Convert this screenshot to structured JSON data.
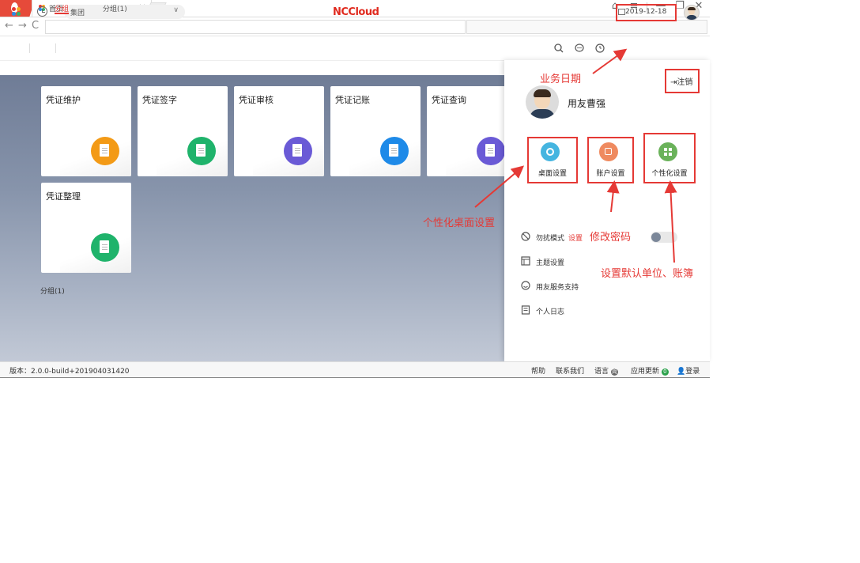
{
  "browser": {
    "tab_title": "首页",
    "tab_close": "×",
    "nav_back": "←",
    "nav_forward": "→",
    "nav_reload": "C",
    "win_controls": [
      "⌂",
      "≡",
      "—",
      "❐",
      "✕"
    ]
  },
  "header": {
    "org_select_value": "集团",
    "org_select_arrow": "∨",
    "logo": "NCCloud",
    "business_date": "2019-12-18"
  },
  "subtabs": [
    "分组",
    "分组(1)"
  ],
  "cards": [
    {
      "title": "凭证维护",
      "color": "#f39a16"
    },
    {
      "title": "凭证签字",
      "color": "#1fb36b"
    },
    {
      "title": "凭证审核",
      "color": "#6a5ad6"
    },
    {
      "title": "凭证记账",
      "color": "#1e8ae8"
    },
    {
      "title": "凭证查询",
      "color": "#6a5ad6"
    },
    {
      "title": "凭证整理",
      "color": "#1fb36b"
    }
  ],
  "group_label": "分组(1)",
  "panel": {
    "logout_label": "注销",
    "user_name": "用友曹强",
    "quick_actions": [
      {
        "label": "桌面设置",
        "color": "#45b5e0"
      },
      {
        "label": "账户设置",
        "color": "#ef8a5f"
      },
      {
        "label": "个性化设置",
        "color": "#6ab25a"
      }
    ],
    "menu": {
      "dnd_label": "勿扰模式",
      "dnd_settings_link": "设置",
      "theme_label": "主题设置",
      "support_label": "用友服务支持",
      "log_label": "个人日志"
    }
  },
  "statusbar": {
    "version": "版本：2.0.0-build+201904031420",
    "help": "帮助",
    "contact": "联系我们",
    "language": "语言",
    "language_badge": "简",
    "updates": "应用更新",
    "updates_count": "0",
    "login": "登录"
  },
  "annotations": {
    "business_date": "业务日期",
    "desktop_settings": "个性化桌面设置",
    "change_password": "修改密码",
    "default_unit": "设置默认单位、账簿"
  },
  "colors": {
    "accent": "#e53935",
    "brand": "#e02a1e"
  }
}
